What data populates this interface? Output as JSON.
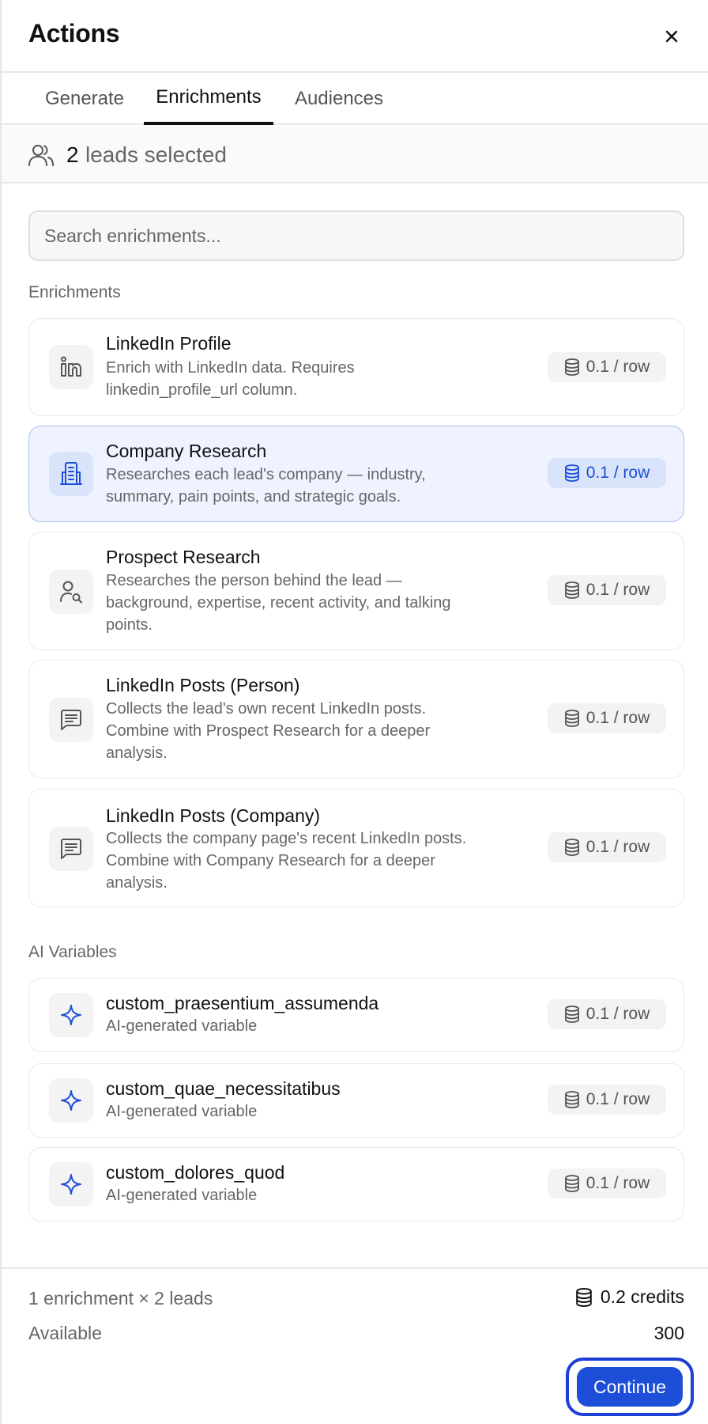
{
  "header": {
    "title": "Actions"
  },
  "tabs": [
    {
      "label": "Generate",
      "active": false
    },
    {
      "label": "Enrichments",
      "active": true
    },
    {
      "label": "Audiences",
      "active": false
    }
  ],
  "selection": {
    "count": "2",
    "text": "leads selected"
  },
  "search": {
    "placeholder": "Search enrichments..."
  },
  "sections": {
    "enrichments": "Enrichments",
    "ai_variables": "AI Variables"
  },
  "enrichments": [
    {
      "title": "LinkedIn Profile",
      "desc_lines": [
        "Enrich with LinkedIn data. Requires",
        "linkedin_profile_url column."
      ],
      "cost": "0.1 / row",
      "icon": "linkedin-icon",
      "selected": false
    },
    {
      "title": "Company Research",
      "desc_lines": [
        "Researches each lead's company — industry,",
        "summary, pain points, and strategic goals."
      ],
      "cost": "0.1 / row",
      "icon": "building-icon",
      "selected": true
    },
    {
      "title": "Prospect Research",
      "desc_lines": [
        "Researches the person behind the lead —",
        "background, expertise, recent activity, and talking",
        "points."
      ],
      "cost": "0.1 / row",
      "icon": "user-search-icon",
      "selected": false
    },
    {
      "title": "LinkedIn Posts (Person)",
      "desc_lines": [
        "Collects the lead's own recent LinkedIn posts.",
        "Combine with Prospect Research for a deeper",
        "analysis."
      ],
      "cost": "0.1 / row",
      "icon": "message-icon",
      "selected": false
    },
    {
      "title": "LinkedIn Posts (Company)",
      "desc_lines": [
        "Collects the company page's recent LinkedIn posts.",
        "Combine with Company Research for a deeper",
        "analysis."
      ],
      "cost": "0.1 / row",
      "icon": "message-icon",
      "selected": false
    }
  ],
  "ai_variables": [
    {
      "title": "custom_praesentium_assumenda",
      "desc": "AI-generated variable",
      "cost": "0.1 / row",
      "icon": "sparkle-icon"
    },
    {
      "title": "custom_quae_necessitatibus",
      "desc": "AI-generated variable",
      "cost": "0.1 / row",
      "icon": "sparkle-icon"
    },
    {
      "title": "custom_dolores_quod",
      "desc": "AI-generated variable",
      "cost": "0.1 / row",
      "icon": "sparkle-icon"
    }
  ],
  "footer": {
    "summary": "1 enrichment × 2 leads",
    "credits": "0.2 credits",
    "available_label": "Available",
    "available_value": "300",
    "continue_label": "Continue"
  },
  "colors": {
    "accent": "#1d4ed8",
    "selected_bg": "#eef3ff",
    "selected_border": "#a9c0f0"
  }
}
